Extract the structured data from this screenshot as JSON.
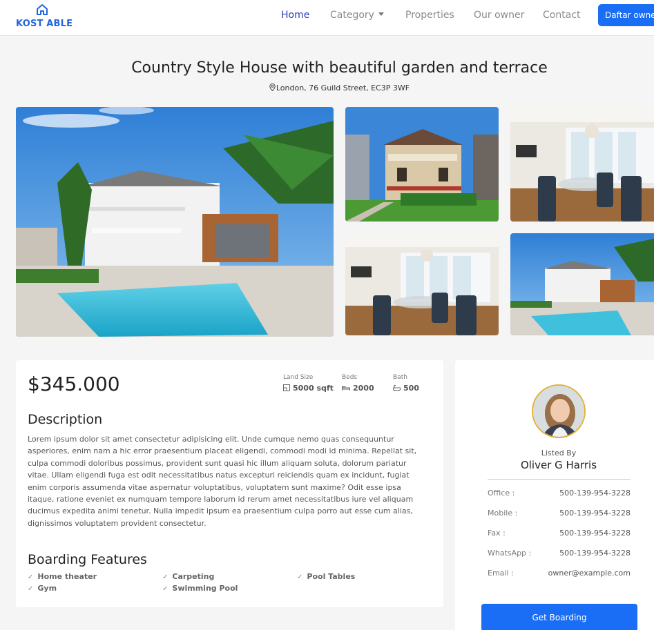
{
  "nav": {
    "brand": "KOST ABLE",
    "links": [
      "Home",
      "Category",
      "Properties",
      "Our owner",
      "Contact"
    ],
    "button": "Daftar owner"
  },
  "property": {
    "title": "Country Style House with beautiful garden and terrace",
    "address": "London, 76 Guild Street, EC3P 3WF",
    "price": "$345.000",
    "stats": [
      {
        "label": "Land Size",
        "value": "5000 sqft",
        "icon": "ruler-icon"
      },
      {
        "label": "Beds",
        "value": "2000",
        "icon": "bed-icon"
      },
      {
        "label": "Bath",
        "value": "500",
        "icon": "bath-icon"
      }
    ],
    "description_heading": "Description",
    "description": "Lorem ipsum dolor sit amet consectetur adipisicing elit. Unde cumque nemo quas consequuntur asperiores, enim nam a hic error praesentium placeat eligendi, commodi modi id minima. Repellat sit, culpa commodi doloribus possimus, provident sunt quasi hic illum aliquam soluta, dolorum pariatur vitae. Ullam eligendi fuga est odit necessitatibus natus excepturi reiciendis quam ex incidunt, fugiat enim corporis assumenda vitae aspernatur voluptatibus, voluptatem sunt maxime? Odit esse ipsa itaque, ratione eveniet ex numquam tempore laborum id rerum amet necessitatibus iure vel aliquam ducimus expedita animi tenetur. Nulla impedit ipsum ea praesentium culpa porro aut esse cum alias, dignissimos voluptatem provident consectetur.",
    "features_heading": "Boarding Features",
    "features": [
      "Home theater",
      "Carpeting",
      "Pool Tables",
      "Gym",
      "Swimming Pool"
    ]
  },
  "agent": {
    "listed_by": "Listed By",
    "name": "Oliver G Harris",
    "contacts": [
      {
        "label": "Office :",
        "value": "500-139-954-3228"
      },
      {
        "label": "Mobile :",
        "value": "500-139-954-3228"
      },
      {
        "label": "Fax :",
        "value": "500-139-954-3228"
      },
      {
        "label": "WhatsApp :",
        "value": "500-139-954-3228"
      },
      {
        "label": "Email :",
        "value": "owner@example.com"
      }
    ],
    "button": "Get Boarding"
  },
  "colors": {
    "accent": "#1a6ef5",
    "brand": "#1f66e0",
    "nav_active": "#2b3fb8",
    "avatar_ring": "#e2b23a"
  }
}
